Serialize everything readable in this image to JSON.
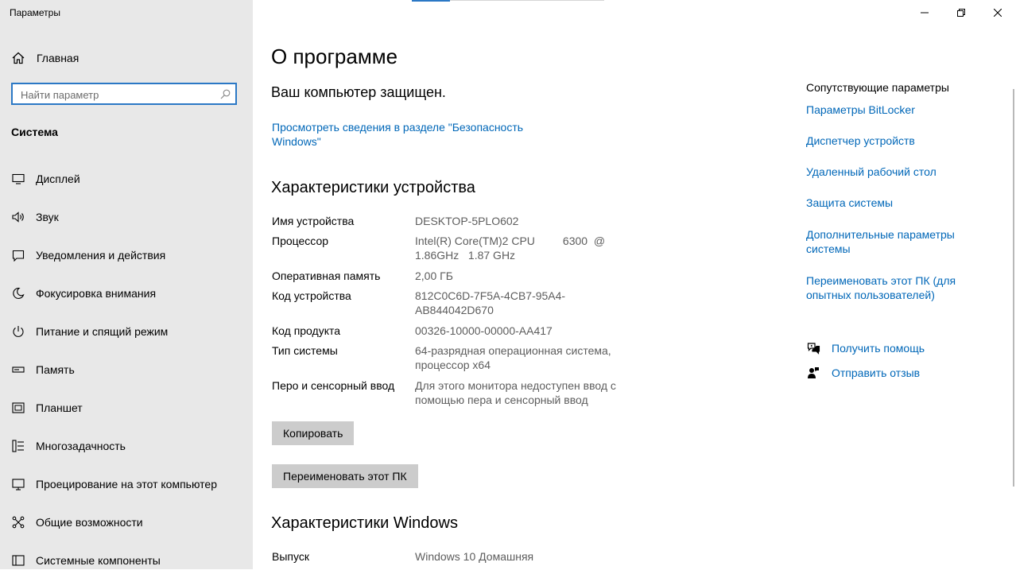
{
  "window": {
    "title": "Параметры",
    "controls": [
      "minimize",
      "restore",
      "close"
    ]
  },
  "sidebar": {
    "home_label": "Главная",
    "search_placeholder": "Найти параметр",
    "section_header": "Система",
    "items": [
      {
        "label": "Дисплей",
        "icon": "display-icon"
      },
      {
        "label": "Звук",
        "icon": "sound-icon"
      },
      {
        "label": "Уведомления и действия",
        "icon": "notifications-icon"
      },
      {
        "label": "Фокусировка внимания",
        "icon": "focus-assist-icon"
      },
      {
        "label": "Питание и спящий режим",
        "icon": "power-icon"
      },
      {
        "label": "Память",
        "icon": "storage-icon"
      },
      {
        "label": "Планшет",
        "icon": "tablet-icon"
      },
      {
        "label": "Многозадачность",
        "icon": "multitasking-icon"
      },
      {
        "label": "Проецирование на этот компьютер",
        "icon": "projecting-icon"
      },
      {
        "label": "Общие возможности",
        "icon": "shared-experiences-icon"
      },
      {
        "label": "Системные компоненты",
        "icon": "system-components-icon"
      }
    ]
  },
  "main": {
    "title": "О программе",
    "protected_heading": "Ваш компьютер защищен.",
    "security_link": "Просмотреть сведения в разделе \"Безопасность Windows\"",
    "device_specs_heading": "Характеристики устройства",
    "device_specs": [
      {
        "key": "Имя устройства",
        "value": "DESKTOP-5PLO602"
      },
      {
        "key": "Процессор",
        "value": "Intel(R) Core(TM)2 CPU         6300  @ 1.86GHz   1.87 GHz"
      },
      {
        "key": "Оперативная память",
        "value": "2,00 ГБ"
      },
      {
        "key": "Код устройства",
        "value": "812C0C6D-7F5A-4CB7-95A4-AB844042D670"
      },
      {
        "key": "Код продукта",
        "value": "00326-10000-00000-AA417"
      },
      {
        "key": "Тип системы",
        "value": "64-разрядная операционная система, процессор x64"
      },
      {
        "key": "Перо и сенсорный ввод",
        "value": "Для этого монитора недоступен ввод с помощью пера и сенсорный ввод"
      }
    ],
    "copy_button": "Копировать",
    "rename_button": "Переименовать этот ПК",
    "windows_specs_heading": "Характеристики Windows",
    "windows_specs": [
      {
        "key": "Выпуск",
        "value": "Windows 10 Домашняя"
      }
    ]
  },
  "related": {
    "title": "Сопутствующие параметры",
    "links": [
      "Параметры BitLocker",
      "Диспетчер устройств",
      "Удаленный рабочий стол",
      "Защита системы",
      "Дополнительные параметры системы",
      "Переименовать этот ПК (для опытных пользователей)"
    ],
    "help": [
      {
        "label": "Получить помощь",
        "icon": "get-help-icon"
      },
      {
        "label": "Отправить отзыв",
        "icon": "feedback-icon"
      }
    ]
  },
  "colors": {
    "accent": "#2b78c5",
    "link": "#0067b8",
    "sidebar_bg": "#e8e8e8",
    "button_bg": "#cccccc",
    "secondary_text": "#5d5d5d"
  }
}
